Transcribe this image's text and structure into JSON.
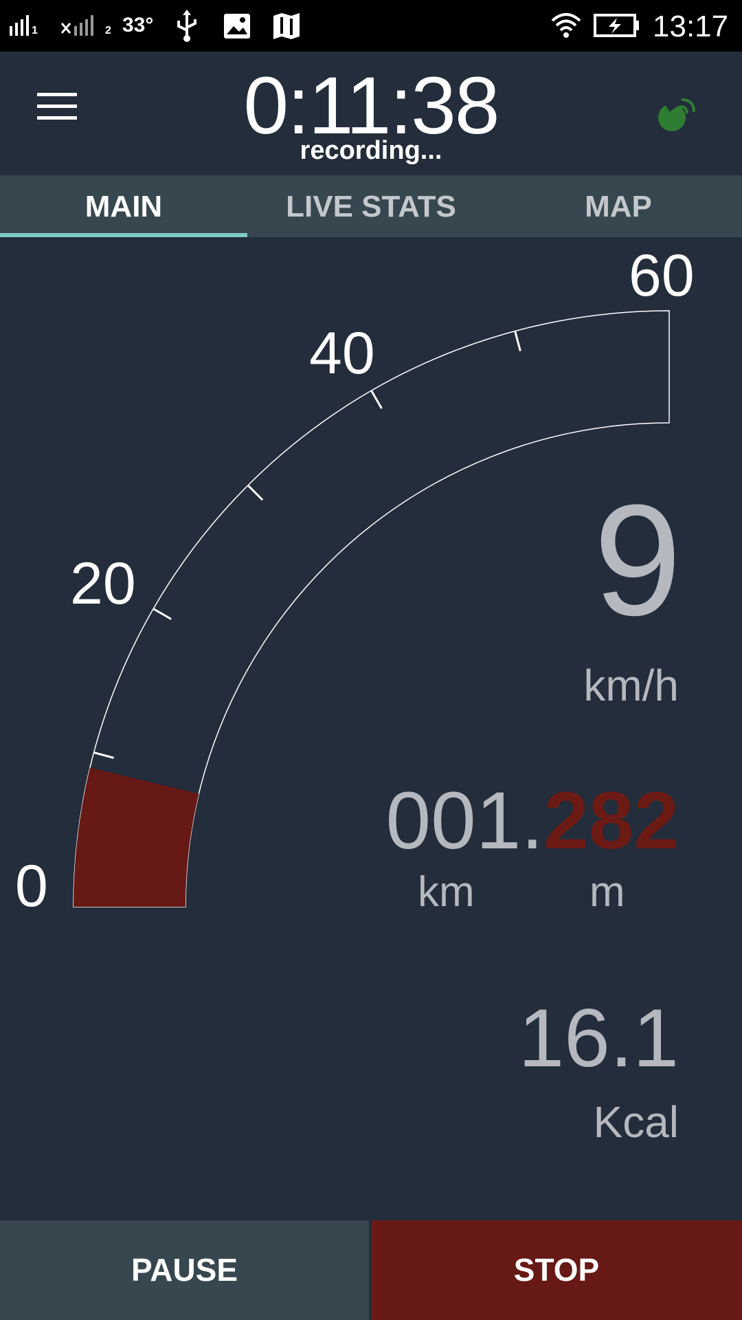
{
  "status_bar": {
    "sim1_label": "1",
    "sim2_label": "2",
    "temperature": "33°",
    "time": "13:17",
    "icons": [
      "signal-sim1-icon",
      "signal-sim2-icon",
      "usb-icon",
      "image-icon",
      "map-icon",
      "wifi-icon",
      "battery-charging-icon"
    ]
  },
  "header": {
    "timer": "0:11:38",
    "status": "recording...",
    "menu_icon": "hamburger-menu-icon",
    "gps_icon": "gps-satellite-icon",
    "gps_color": "#2e7d32"
  },
  "tabs": [
    {
      "label": "MAIN",
      "active": true
    },
    {
      "label": "LIVE STATS",
      "active": false
    },
    {
      "label": "MAP",
      "active": false
    }
  ],
  "gauge": {
    "labels": [
      "0",
      "20",
      "40",
      "60"
    ],
    "min": 0,
    "max": 60,
    "value": 9,
    "fill_color": "#661915"
  },
  "speed": {
    "value": "9",
    "unit": "km/h"
  },
  "distance": {
    "km_part": "001.",
    "m_part": "282",
    "km_unit": "km",
    "m_unit": "m"
  },
  "calories": {
    "value": "16.1",
    "unit": "Kcal"
  },
  "buttons": {
    "pause": "PAUSE",
    "stop": "STOP"
  },
  "colors": {
    "background": "#232d3b",
    "tab_bar": "#37474f",
    "tab_indicator": "#80cbc4",
    "stop_button": "#661915",
    "accent_red": "#6b1a14"
  }
}
